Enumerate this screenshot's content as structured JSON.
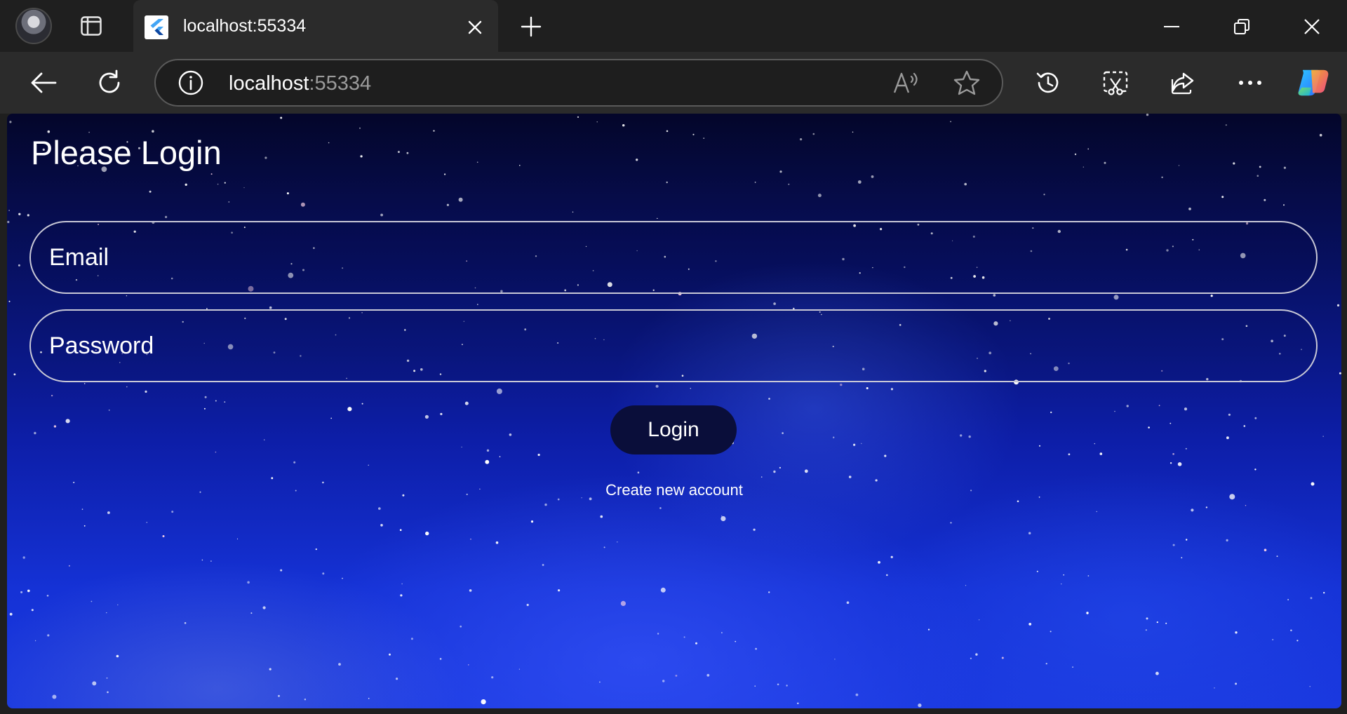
{
  "browser": {
    "tab": {
      "title": "localhost:55334"
    },
    "address": {
      "host": "localhost",
      "port": ":55334"
    }
  },
  "page": {
    "title": "Please Login",
    "email": {
      "placeholder": "Email",
      "value": ""
    },
    "password": {
      "placeholder": "Password",
      "value": ""
    },
    "login_label": "Login",
    "create_account_label": "Create new account"
  },
  "colors": {
    "chrome_bg": "#1f1f1f",
    "toolbar_bg": "#2b2b2b",
    "button_bg": "#0a0e3a",
    "field_border": "#c8c8d6"
  }
}
